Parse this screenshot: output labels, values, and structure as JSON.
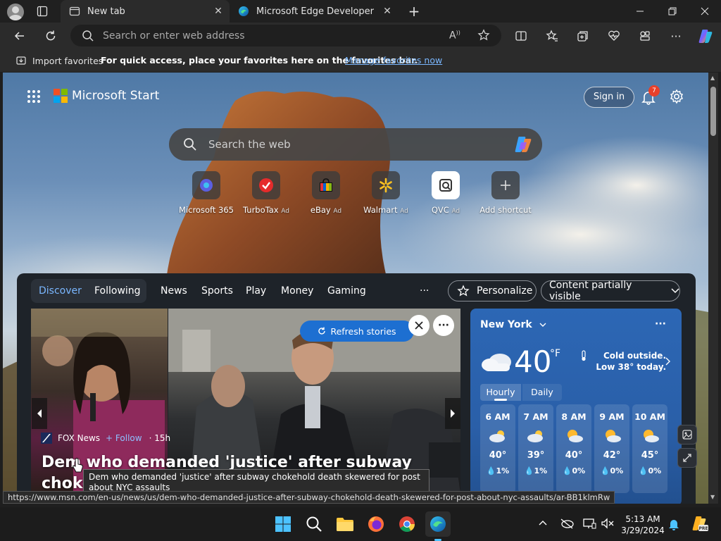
{
  "tabs": [
    {
      "label": "New tab",
      "active": true
    },
    {
      "label": "Microsoft Edge Developer",
      "active": false
    }
  ],
  "address": {
    "placeholder": "Search or enter web address"
  },
  "favorites_bar": {
    "import_label": "Import favorites",
    "hint": "For quick access, place your favorites here on the favorites bar.",
    "manage_link": "Manage favorites now"
  },
  "page": {
    "brand": "Microsoft Start",
    "sign_in": "Sign in",
    "notifications_count": "7",
    "search_placeholder": "Search the web",
    "shortcuts": [
      {
        "label": "Microsoft 365",
        "ad": ""
      },
      {
        "label": "TurboTax",
        "ad": "Ad"
      },
      {
        "label": "eBay",
        "ad": "Ad"
      },
      {
        "label": "Walmart",
        "ad": "Ad"
      },
      {
        "label": "QVC",
        "ad": "Ad"
      },
      {
        "label": "Add shortcut",
        "ad": ""
      }
    ]
  },
  "feed": {
    "tabs": [
      "Discover",
      "Following",
      "News",
      "Sports",
      "Play",
      "Money",
      "Gaming"
    ],
    "more": "···",
    "personalize": "Personalize",
    "content_visibility": "Content partially visible",
    "refresh": "Refresh stories",
    "story": {
      "source": "FOX News",
      "follow": "+ Follow",
      "age": "· 15h",
      "headline": "Dem who demanded 'justice' after subway choke"
    }
  },
  "weather": {
    "location": "New York",
    "temp": "40",
    "unit": "°F",
    "summary": "Cold outside. Low 38° today.",
    "tab_hourly": "Hourly",
    "tab_daily": "Daily",
    "hours": [
      {
        "time": "6 AM",
        "temp": "40°",
        "precip": "1%",
        "icon": "cloudy-icon"
      },
      {
        "time": "7 AM",
        "temp": "39°",
        "precip": "1%",
        "icon": "cloudy-icon"
      },
      {
        "time": "8 AM",
        "temp": "40°",
        "precip": "0%",
        "icon": "partly-sunny-icon"
      },
      {
        "time": "9 AM",
        "temp": "42°",
        "precip": "0%",
        "icon": "partly-sunny-icon"
      },
      {
        "time": "10 AM",
        "temp": "45°",
        "precip": "0%",
        "icon": "partly-sunny-icon"
      }
    ]
  },
  "tooltip": "Dem who demanded 'justice' after subway chokehold death skewered for post about NYC assaults",
  "status_url": "https://www.msn.com/en-us/news/us/dem-who-demanded-justice-after-subway-chokehold-death-skewered-for-post-about-nyc-assaults/ar-BB1klmRw",
  "taskbar": {
    "time": "5:13 AM",
    "date": "3/29/2024"
  },
  "colors": {
    "accent": "#1d6fd1",
    "link": "#7ab7ff",
    "weather": "#2c67b5"
  }
}
